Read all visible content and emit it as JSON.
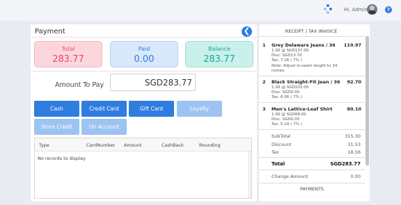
{
  "header": {
    "greeting": "Hi, Admin",
    "spinner_icon": "loading-dots-icon",
    "avatar_icon": "user-avatar-icon",
    "help_icon": "help-icon",
    "help_glyph": "?"
  },
  "payment": {
    "title": "Payment",
    "back_glyph": "❮",
    "summary": {
      "total_label": "Total",
      "total_value": "283.77",
      "paid_label": "Paid",
      "paid_value": "0.00",
      "balance_label": "Balance",
      "balance_value": "283.77"
    },
    "amount_to_pay_label": "Amount To Pay",
    "amount_to_pay_value": "SGD283.77",
    "methods": [
      {
        "label": "Cash",
        "enabled": true
      },
      {
        "label": "Credit Card",
        "enabled": true
      },
      {
        "label": "Gift Card",
        "enabled": true
      },
      {
        "label": "Loyalty",
        "enabled": false
      },
      {
        "label": "Store Credit",
        "enabled": false
      },
      {
        "label": "On Account",
        "enabled": false
      }
    ],
    "table": {
      "columns": [
        "Type",
        "CardNumber",
        "Amount",
        "CashBack",
        "Rounding"
      ],
      "empty_text": "No records to display"
    }
  },
  "receipt": {
    "title": "RECEIPT / TAX INVOICE",
    "items": [
      {
        "num": "1",
        "name": "Grey Delaware Jeans / 36",
        "amount": "110.97",
        "details": [
          "1.00 @ SGD137.00",
          "Disc: SGD13.70",
          "Tax: 7.26 ( 7% )",
          "Note: Adjust in-seam length to 34 inches."
        ]
      },
      {
        "num": "2",
        "name": "Black Straight-Fit Jean / 36",
        "amount": "92.70",
        "details": [
          "1.00 @ SGD103.00",
          "Disc: SGD0.00",
          "Tax: 6.06 ( 7% )"
        ]
      },
      {
        "num": "3",
        "name": "Men's Lattice-Leaf Shirt",
        "amount": "80.10",
        "details": [
          "1.00 @ SGD89.00",
          "Disc: SGD0.00",
          "Tax: 5.24 ( 7% )"
        ]
      }
    ],
    "subtotal_label": "SubTotal",
    "subtotal_value": "315.30",
    "discount_label": "Discount",
    "discount_value": "31.53",
    "tax_label": "Tax",
    "tax_value": "18.56",
    "total_label": "Total",
    "total_value": "SGD283.77",
    "change_label": "Change Amount",
    "change_value": "0.00",
    "payments_label": "PAYMENTS"
  }
}
